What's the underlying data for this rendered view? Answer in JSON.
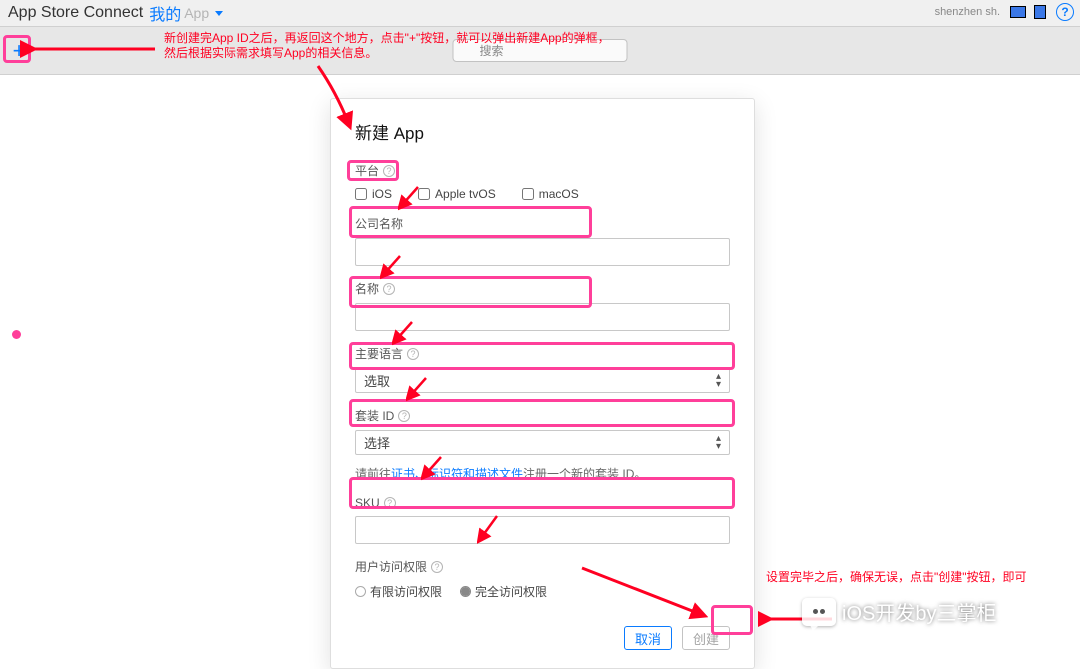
{
  "topbar": {
    "title": "App Store Connect",
    "my_label": "我的",
    "app_label": "App",
    "user": "shenzhen sh."
  },
  "toolbar": {
    "plus_symbol": "+",
    "search_placeholder": "搜索"
  },
  "annotations": {
    "top": "新创建完App ID之后，再返回这个地方，点击\"+\"按钮，就可以弹出新建App的弹框，\n然后根据实际需求填写App的相关信息。",
    "bottom": "设置完毕之后，确保无误，点击\"创建\"按钮，即可"
  },
  "modal": {
    "title": "新建 App",
    "platform_label": "平台",
    "platform_options": {
      "ios": "iOS",
      "tvos": "Apple tvOS",
      "macos": "macOS"
    },
    "company_label": "公司名称",
    "name_label": "名称",
    "lang_label": "主要语言",
    "lang_value": "选取",
    "bundle_label": "套装 ID",
    "bundle_value": "选择",
    "bundle_hint_pre": "请前往",
    "bundle_hint_link": "证书、标识符和描述文件",
    "bundle_hint_post": "注册一个新的套装 ID。",
    "sku_label": "SKU",
    "access_label": "用户访问权限",
    "access_limited": "有限访问权限",
    "access_full": "完全访问权限",
    "cancel": "取消",
    "create": "创建"
  },
  "watermark": {
    "text": "iOS开发by三掌柜"
  }
}
